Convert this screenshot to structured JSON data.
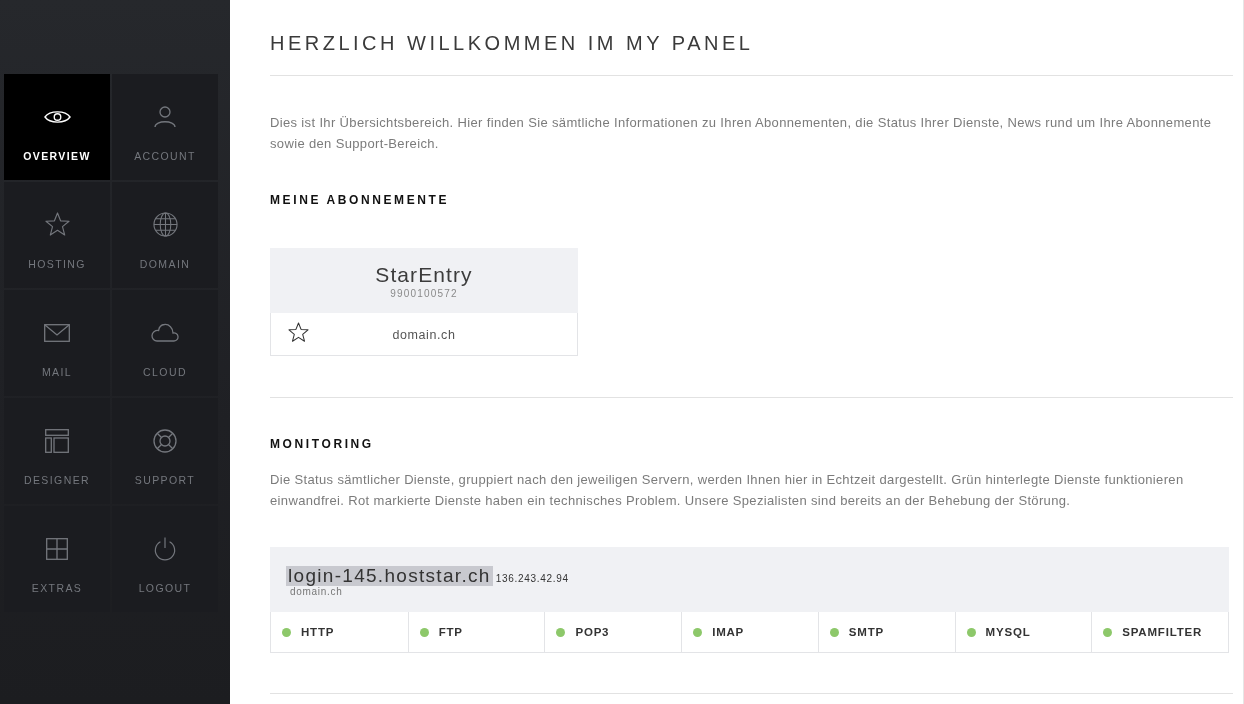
{
  "sidebar": {
    "items": [
      {
        "label": "OVERVIEW",
        "selected": true
      },
      {
        "label": "ACCOUNT",
        "selected": false
      },
      {
        "label": "HOSTING",
        "selected": false
      },
      {
        "label": "DOMAIN",
        "selected": false
      },
      {
        "label": "MAIL",
        "selected": false
      },
      {
        "label": "CLOUD",
        "selected": false
      },
      {
        "label": "DESIGNER",
        "selected": false
      },
      {
        "label": "SUPPORT",
        "selected": false
      },
      {
        "label": "EXTRAS",
        "selected": false
      },
      {
        "label": "LOGOUT",
        "selected": false
      }
    ]
  },
  "page": {
    "title": "HERZLICH WILLKOMMEN IM MY PANEL",
    "intro": "Dies ist Ihr Übersichtsbereich. Hier finden Sie sämtliche Informationen zu Ihren Abonnementen, die Status Ihrer Dienste, News rund um Ihre Abonnemente sowie den Support-Bereich."
  },
  "subscriptions": {
    "heading": "MEINE ABONNEMENTE",
    "cards": [
      {
        "name": "StarEntry",
        "number": "9900100572",
        "domain": "domain.ch",
        "starred": false
      }
    ]
  },
  "monitoring": {
    "heading": "MONITORING",
    "description": "Die Status sämtlicher Dienste, gruppiert nach den jeweiligen Servern, werden Ihnen hier in Echtzeit dargestellt. Grün hinterlegte Dienste funktionieren einwandfrei. Rot markierte Dienste haben ein technisches Problem. Unsere Spezialisten sind bereits an der Behebung der Störung.",
    "servers": [
      {
        "hostname": "login-145.hoststar.ch",
        "hostname_highlighted": true,
        "ip": "136.243.42.94",
        "domain": "domain.ch",
        "services": [
          {
            "name": "HTTP",
            "color": "#8dc86a"
          },
          {
            "name": "FTP",
            "color": "#8dc86a"
          },
          {
            "name": "POP3",
            "color": "#8dc86a"
          },
          {
            "name": "IMAP",
            "color": "#8dc86a"
          },
          {
            "name": "SMTP",
            "color": "#8dc86a"
          },
          {
            "name": "MYSQL",
            "color": "#8dc86a"
          },
          {
            "name": "SPAMFILTER",
            "color": "#8dc86a"
          }
        ]
      }
    ]
  }
}
